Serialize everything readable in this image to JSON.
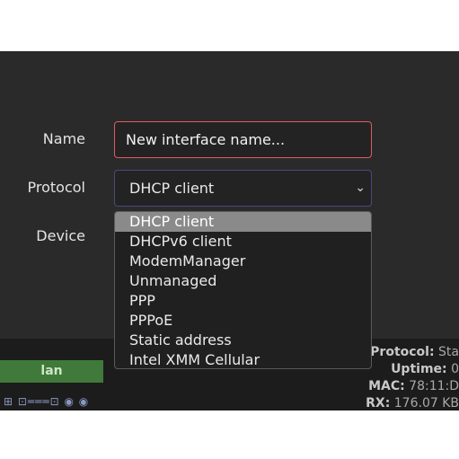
{
  "form": {
    "name_label": "Name",
    "name_placeholder": "New interface name...",
    "protocol_label": "Protocol",
    "protocol_selected": "DHCP client",
    "device_label": "Device"
  },
  "dropdown": {
    "options": [
      "DHCP client",
      "DHCPv6 client",
      "ModemManager",
      "Unmanaged",
      "PPP",
      "PPPoE",
      "Static address",
      "Intel XMM Cellular"
    ],
    "selected_index": 0
  },
  "background": {
    "lan_label": "lan",
    "stats": [
      {
        "label": "Protocol:",
        "value": "Sta"
      },
      {
        "label": "Uptime:",
        "value": "0"
      },
      {
        "label": "MAC:",
        "value": "78:11:D"
      },
      {
        "label": "RX:",
        "value": "176.07 KB"
      }
    ]
  },
  "icons": {
    "chevron": "chevron-down-icon",
    "port_icons": "network-port-icons"
  }
}
